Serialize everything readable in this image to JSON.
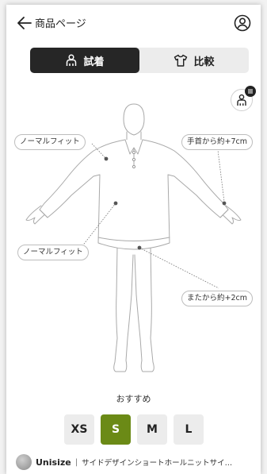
{
  "header": {
    "title": "商品ページ",
    "back_icon": "arrow-left-icon",
    "account_icon": "account-circle-icon"
  },
  "tabs": [
    {
      "label": "試着",
      "icon": "person-icon",
      "active": true
    },
    {
      "label": "比較",
      "icon": "shirt-icon",
      "active": false
    }
  ],
  "avatar_button": {
    "icon": "avatar-settings-icon"
  },
  "fit_notes": {
    "shoulder_left": "ノーマルフィット",
    "wrist_right": "手首から約+7cm",
    "waist_left": "ノーマルフィット",
    "hem_right": "またから約+2cm"
  },
  "recommend": {
    "label": "おすすめ"
  },
  "sizes": [
    {
      "label": "XS",
      "selected": false
    },
    {
      "label": "S",
      "selected": true
    },
    {
      "label": "M",
      "selected": false
    },
    {
      "label": "L",
      "selected": false
    }
  ],
  "footer": {
    "brand": "Unisize",
    "separator": "|",
    "product": "サイドデザインショートホールニットサイ…"
  },
  "colors": {
    "accent": "#6b8a16",
    "dark": "#262626"
  }
}
